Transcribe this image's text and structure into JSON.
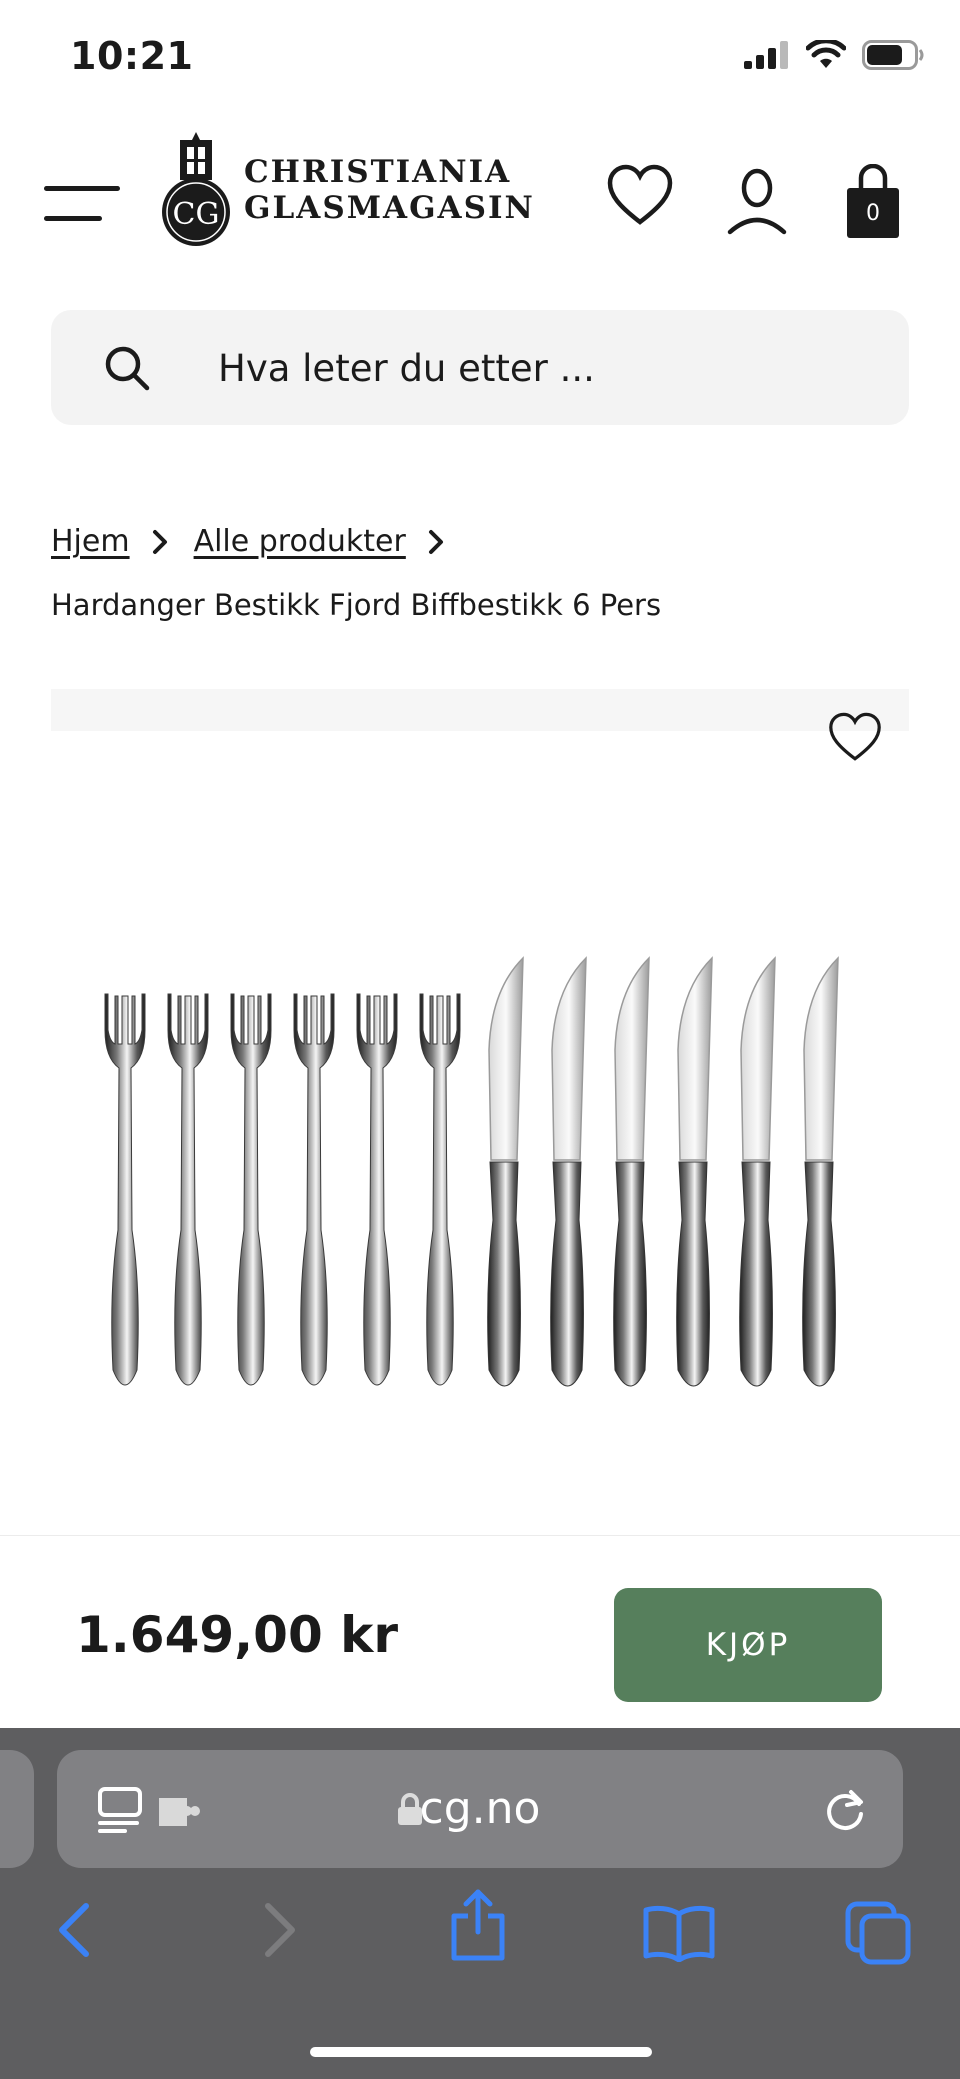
{
  "status_bar": {
    "time": "10:21",
    "battery_fraction": 0.75
  },
  "header": {
    "logo": {
      "monogram": "CG",
      "line1": "CHRISTIANIA",
      "line2": "GLASMAGASIN"
    },
    "cart_count": "0"
  },
  "search": {
    "placeholder": "Hva leter du etter ..."
  },
  "breadcrumb": {
    "items": [
      {
        "label": "Hjem"
      },
      {
        "label": "Alle produkter"
      }
    ],
    "current": "Hardanger Bestikk Fjord Biffbestikk 6 Pers"
  },
  "product": {
    "title": "Hardanger Bestikk Fjord Biffbestikk 6 Pers",
    "fork_count": 6,
    "knife_count": 6
  },
  "buy_bar": {
    "price": "1.649,00 kr",
    "buy_label": "KJØP"
  },
  "browser": {
    "url": "cg.no"
  },
  "colors": {
    "buy_button": "#567f5c",
    "search_bg": "#f3f3f3",
    "safari_bg": "#5e5e60",
    "safari_accent": "#3b82f6"
  }
}
